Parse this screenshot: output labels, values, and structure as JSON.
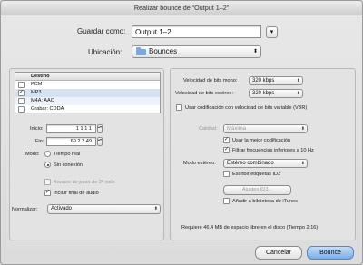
{
  "window": {
    "title": "Realizar bounce de “Output 1–2”"
  },
  "save": {
    "label": "Guardar como:",
    "value": "Output 1–2",
    "expand_glyph": "▾"
  },
  "location": {
    "label": "Ubicación:",
    "value": "Bounces"
  },
  "destinations": {
    "header": "Destino",
    "items": [
      {
        "label": "PCM",
        "checked": false
      },
      {
        "label": "MP3",
        "checked": true
      },
      {
        "label": "M4A: AAC",
        "checked": false
      },
      {
        "label": "Grabar: CDDA",
        "checked": false
      }
    ]
  },
  "range": {
    "start_label": "Inicio:",
    "start_value": "1   1   1   1",
    "end_label": "Fin:",
    "end_value": "69   2   2   49"
  },
  "mode": {
    "label": "Modo:",
    "options": [
      {
        "label": "Tiempo real",
        "selected": false
      },
      {
        "label": "Sin conexión",
        "selected": true
      }
    ]
  },
  "options_left": {
    "second_cycle": "Bounce de paso de 2º ciclo",
    "include_tail": "Incluir final de audio"
  },
  "normalize": {
    "label": "Normalizar:",
    "value": "Activado"
  },
  "mp3": {
    "mono_label": "Velocidad de bits mono:",
    "mono_value": "320 kbps",
    "stereo_label": "Velocidad de bits estéreo:",
    "stereo_value": "320 kbps",
    "vbr_label": "Usar codificación con velocidad de bits variable (VBR)",
    "quality_label": "Calidad:",
    "quality_value": "Máxima",
    "best_encoding": "Usar la mejor codificación",
    "filter": "Filtrar frecuencias inferiores a 10 Hz",
    "stereo_mode_label": "Modo estéreo:",
    "stereo_mode_value": "Estéreo combinado",
    "id3_write": "Escribir etiquetas ID3",
    "id3_button": "Ajustes ID3...",
    "itunes": "Añadir a biblioteca de iTunes"
  },
  "disk_info": "Requiere 46.4 MB de espacio libre en el disco (Tiempo 2:16)",
  "buttons": {
    "cancel": "Cancelar",
    "bounce": "Bounce"
  },
  "icons": {
    "checkmark": "✓",
    "popup_arrows": "⬍",
    "stepper": "▴▾",
    "folder": "folder-icon"
  },
  "colors": {
    "accent": "#7aaee6",
    "selection": "#d7e2f0"
  }
}
